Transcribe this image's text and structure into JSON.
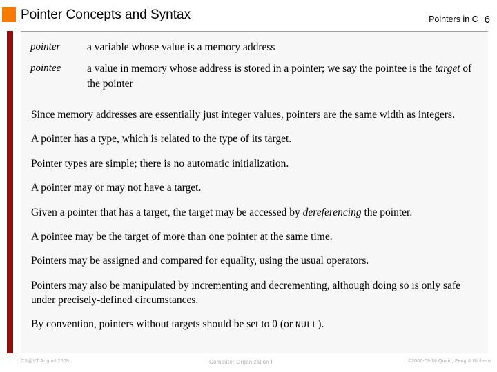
{
  "header": {
    "title": "Pointer Concepts and Syntax",
    "subject": "Pointers in C",
    "slide_number": "6",
    "bullet_icon": "orange-square-icon",
    "bullet_color": "#F57C00"
  },
  "accent": {
    "bar_color": "#8C1111"
  },
  "definitions": [
    {
      "term": "pointer",
      "desc_before": "a variable whose value is a memory address",
      "desc_em": "",
      "desc_after": ""
    },
    {
      "term": "pointee",
      "desc_before": "a value in memory whose address is stored in a pointer; we say the pointee is the ",
      "desc_em": "target",
      "desc_after": " of the pointer"
    }
  ],
  "paragraphs": [
    {
      "before": "Since memory addresses are essentially just integer values, pointers are the same width as integers.",
      "em": "",
      "after": "",
      "code": "",
      "tail": ""
    },
    {
      "before": "A pointer has a type, which is related to the type of its target.",
      "em": "",
      "after": "",
      "code": "",
      "tail": ""
    },
    {
      "before": "Pointer types are simple; there is no automatic initialization.",
      "em": "",
      "after": "",
      "code": "",
      "tail": ""
    },
    {
      "before": "A pointer may or may not have a target.",
      "em": "",
      "after": "",
      "code": "",
      "tail": ""
    },
    {
      "before": "Given a pointer that has a target, the target may be accessed by ",
      "em": "dereferencing",
      "after": " the pointer.",
      "code": "",
      "tail": ""
    },
    {
      "before": "A pointee may be the target of more than one pointer at the same time.",
      "em": "",
      "after": "",
      "code": "",
      "tail": ""
    },
    {
      "before": "Pointers may be assigned and compared for equality, using the usual operators.",
      "em": "",
      "after": "",
      "code": "",
      "tail": ""
    },
    {
      "before": "Pointers may also be manipulated by incrementing and decrementing, although doing so is only safe under precisely-defined circumstances.",
      "em": "",
      "after": "",
      "code": "",
      "tail": ""
    },
    {
      "before": "By convention, pointers without targets should be set to 0 (or ",
      "em": "",
      "after": "",
      "code": "NULL",
      "tail": ")."
    }
  ],
  "footer": {
    "left": "CS@VT August 2009",
    "center": "Computer Organization I",
    "right": "©2006-09 McQuain, Feng & Ribbens"
  }
}
